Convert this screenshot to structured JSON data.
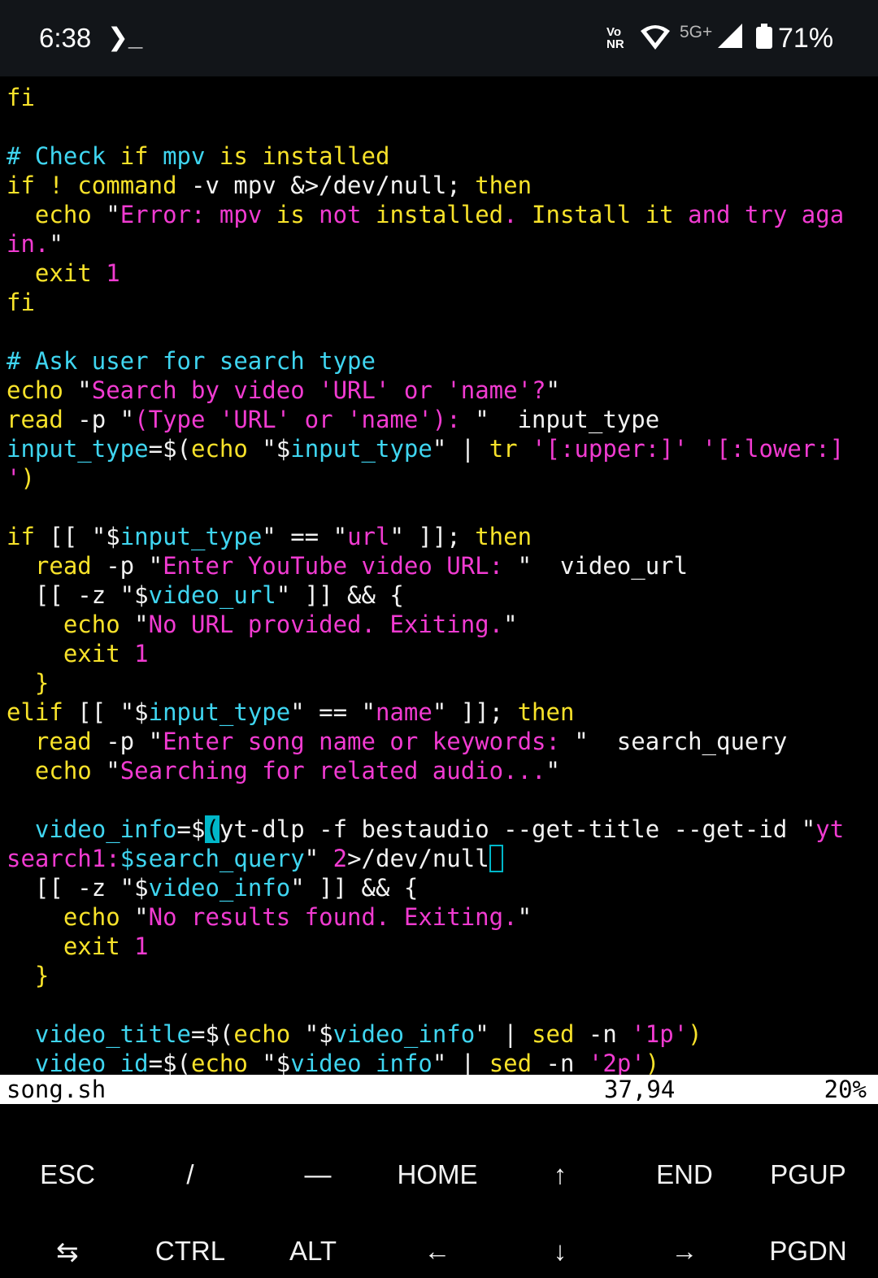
{
  "status_bar": {
    "time": "6:38",
    "terminal_glyph": "❯_",
    "volte_line1": "Vo",
    "volte_line2": "NR",
    "network": "5G+",
    "battery": "71%"
  },
  "editor": {
    "lines": [
      [
        {
          "t": "fi",
          "c": "y"
        }
      ],
      [],
      [
        {
          "t": "# Check ",
          "c": "c"
        },
        {
          "t": "if",
          "c": "y"
        },
        {
          "t": " mpv ",
          "c": "c"
        },
        {
          "t": "is",
          "c": "y"
        },
        {
          "t": " ",
          "c": "c"
        },
        {
          "t": "installed",
          "c": "y"
        }
      ],
      [
        {
          "t": "if",
          "c": "y"
        },
        {
          "t": " ",
          "c": "w"
        },
        {
          "t": "!",
          "c": "y"
        },
        {
          "t": " ",
          "c": "w"
        },
        {
          "t": "command",
          "c": "y"
        },
        {
          "t": " -v mpv &>/dev/null; ",
          "c": "w"
        },
        {
          "t": "then",
          "c": "y"
        }
      ],
      [
        {
          "t": "  ",
          "c": "w"
        },
        {
          "t": "echo",
          "c": "y"
        },
        {
          "t": " \"",
          "c": "w"
        },
        {
          "t": "Error: mpv ",
          "c": "m"
        },
        {
          "t": "is",
          "c": "y"
        },
        {
          "t": " not ",
          "c": "m"
        },
        {
          "t": "installed",
          "c": "y"
        },
        {
          "t": ". ",
          "c": "m"
        },
        {
          "t": "Install it",
          "c": "y"
        },
        {
          "t": " and try aga",
          "c": "m"
        }
      ],
      [
        {
          "t": "in.",
          "c": "m"
        },
        {
          "t": "\"",
          "c": "w"
        }
      ],
      [
        {
          "t": "  ",
          "c": "w"
        },
        {
          "t": "exit",
          "c": "y"
        },
        {
          "t": " 1",
          "c": "m"
        }
      ],
      [
        {
          "t": "fi",
          "c": "y"
        }
      ],
      [],
      [
        {
          "t": "# Ask user for search type",
          "c": "c"
        }
      ],
      [
        {
          "t": "echo",
          "c": "y"
        },
        {
          "t": " \"",
          "c": "w"
        },
        {
          "t": "Search by video ",
          "c": "m"
        },
        {
          "t": "'URL'",
          "c": "m"
        },
        {
          "t": " or ",
          "c": "m"
        },
        {
          "t": "'name'",
          "c": "m"
        },
        {
          "t": "?",
          "c": "m"
        },
        {
          "t": "\"",
          "c": "w"
        }
      ],
      [
        {
          "t": "read",
          "c": "y"
        },
        {
          "t": " -p \"",
          "c": "w"
        },
        {
          "t": "(Type 'URL' or 'name'): ",
          "c": "m"
        },
        {
          "t": "\"",
          "c": "w"
        },
        {
          "t": "  input_type",
          "c": "w"
        }
      ],
      [
        {
          "t": "input_type",
          "c": "c"
        },
        {
          "t": "=$(",
          "c": "w"
        },
        {
          "t": "echo",
          "c": "y"
        },
        {
          "t": " \"$",
          "c": "w"
        },
        {
          "t": "input_type",
          "c": "c"
        },
        {
          "t": "\" | ",
          "c": "w"
        },
        {
          "t": "tr",
          "c": "y"
        },
        {
          "t": " ",
          "c": "w"
        },
        {
          "t": "'[:upper:]'",
          "c": "m"
        },
        {
          "t": " ",
          "c": "w"
        },
        {
          "t": "'[:lower:]",
          "c": "m"
        }
      ],
      [
        {
          "t": "'",
          "c": "m"
        },
        {
          "t": ")",
          "c": "y"
        }
      ],
      [],
      [
        {
          "t": "if",
          "c": "y"
        },
        {
          "t": " [[ \"$",
          "c": "w"
        },
        {
          "t": "input_type",
          "c": "c"
        },
        {
          "t": "\" == \"",
          "c": "w"
        },
        {
          "t": "url",
          "c": "m"
        },
        {
          "t": "\" ]]; ",
          "c": "w"
        },
        {
          "t": "then",
          "c": "y"
        }
      ],
      [
        {
          "t": "  ",
          "c": "w"
        },
        {
          "t": "read",
          "c": "y"
        },
        {
          "t": " -p \"",
          "c": "w"
        },
        {
          "t": "Enter YouTube video URL: ",
          "c": "m"
        },
        {
          "t": "\"  video_url",
          "c": "w"
        }
      ],
      [
        {
          "t": "  [[ -z \"$",
          "c": "w"
        },
        {
          "t": "video_url",
          "c": "c"
        },
        {
          "t": "\" ]] && {",
          "c": "w"
        }
      ],
      [
        {
          "t": "    ",
          "c": "w"
        },
        {
          "t": "echo",
          "c": "y"
        },
        {
          "t": " \"",
          "c": "w"
        },
        {
          "t": "No URL provided. Exiting.",
          "c": "m"
        },
        {
          "t": "\"",
          "c": "w"
        }
      ],
      [
        {
          "t": "    ",
          "c": "w"
        },
        {
          "t": "exit",
          "c": "y"
        },
        {
          "t": " 1",
          "c": "m"
        }
      ],
      [
        {
          "t": "  }",
          "c": "y"
        }
      ],
      [
        {
          "t": "elif",
          "c": "y"
        },
        {
          "t": " [[ \"$",
          "c": "w"
        },
        {
          "t": "input_type",
          "c": "c"
        },
        {
          "t": "\" == \"",
          "c": "w"
        },
        {
          "t": "name",
          "c": "m"
        },
        {
          "t": "\" ]]; ",
          "c": "w"
        },
        {
          "t": "then",
          "c": "y"
        }
      ],
      [
        {
          "t": "  ",
          "c": "w"
        },
        {
          "t": "read",
          "c": "y"
        },
        {
          "t": " -p \"",
          "c": "w"
        },
        {
          "t": "Enter song name or keywords: ",
          "c": "m"
        },
        {
          "t": "\"  search_query",
          "c": "w"
        }
      ],
      [
        {
          "t": "  ",
          "c": "w"
        },
        {
          "t": "echo",
          "c": "y"
        },
        {
          "t": " \"",
          "c": "w"
        },
        {
          "t": "Searching for related audio...",
          "c": "m"
        },
        {
          "t": "\"",
          "c": "w"
        }
      ],
      [],
      [
        {
          "t": "  ",
          "c": "w"
        },
        {
          "t": "video_info",
          "c": "c"
        },
        {
          "t": "=$",
          "c": "w"
        },
        {
          "t": "(",
          "c": "cursor"
        },
        {
          "t": "yt-dlp -f bestaudio --get-title --get-id \"",
          "c": "w"
        },
        {
          "t": "yt",
          "c": "m"
        }
      ],
      [
        {
          "t": "search1:",
          "c": "m"
        },
        {
          "t": "$",
          "c": "c"
        },
        {
          "t": "search_query",
          "c": "c"
        },
        {
          "t": "\" ",
          "c": "w"
        },
        {
          "t": "2",
          "c": "m"
        },
        {
          "t": ">/dev/null",
          "c": "w"
        },
        {
          "t": ")",
          "c": "match"
        }
      ],
      [
        {
          "t": "  [[ -z \"$",
          "c": "w"
        },
        {
          "t": "video_info",
          "c": "c"
        },
        {
          "t": "\" ]] && {",
          "c": "w"
        }
      ],
      [
        {
          "t": "    ",
          "c": "w"
        },
        {
          "t": "echo",
          "c": "y"
        },
        {
          "t": " \"",
          "c": "w"
        },
        {
          "t": "No results found. Exiting.",
          "c": "m"
        },
        {
          "t": "\"",
          "c": "w"
        }
      ],
      [
        {
          "t": "    ",
          "c": "w"
        },
        {
          "t": "exit",
          "c": "y"
        },
        {
          "t": " 1",
          "c": "m"
        }
      ],
      [
        {
          "t": "  }",
          "c": "y"
        }
      ],
      [],
      [
        {
          "t": "  ",
          "c": "w"
        },
        {
          "t": "video_title",
          "c": "c"
        },
        {
          "t": "=$(",
          "c": "w"
        },
        {
          "t": "echo",
          "c": "y"
        },
        {
          "t": " \"$",
          "c": "w"
        },
        {
          "t": "video_info",
          "c": "c"
        },
        {
          "t": "\" | ",
          "c": "w"
        },
        {
          "t": "sed",
          "c": "y"
        },
        {
          "t": " -n ",
          "c": "w"
        },
        {
          "t": "'1p'",
          "c": "m"
        },
        {
          "t": ")",
          "c": "y"
        }
      ],
      [
        {
          "t": "  ",
          "c": "w"
        },
        {
          "t": "video_id",
          "c": "c"
        },
        {
          "t": "=$(",
          "c": "w"
        },
        {
          "t": "echo",
          "c": "y"
        },
        {
          "t": " \"$",
          "c": "w"
        },
        {
          "t": "video_info",
          "c": "c"
        },
        {
          "t": "\" | ",
          "c": "w"
        },
        {
          "t": "sed",
          "c": "y"
        },
        {
          "t": " -n ",
          "c": "w"
        },
        {
          "t": "'2p'",
          "c": "m"
        },
        {
          "t": ")",
          "c": "y"
        }
      ]
    ]
  },
  "statusline": {
    "file": "song.sh",
    "position": "37,94",
    "percent": "20%"
  },
  "extra_keys": {
    "row1": [
      "ESC",
      "/",
      "—",
      "HOME",
      "↑",
      "END",
      "PGUP"
    ],
    "row2": [
      "⇆",
      "CTRL",
      "ALT",
      "←",
      "↓",
      "→",
      "PGDN"
    ]
  }
}
